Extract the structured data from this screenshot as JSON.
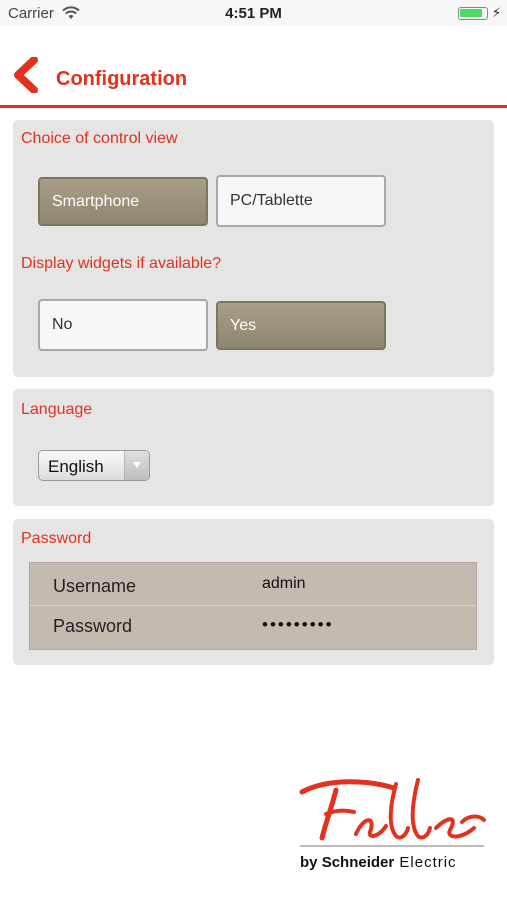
{
  "status_bar": {
    "carrier": "Carrier",
    "time": "4:51 PM",
    "battery_level": 1.0
  },
  "header": {
    "title": "Configuration",
    "back_icon": "chevron-left-icon"
  },
  "control_view": {
    "title": "Choice of control view",
    "options": [
      "Smartphone",
      "PC/Tablette"
    ],
    "selected": "Smartphone"
  },
  "widgets": {
    "title": "Display widgets if available?",
    "options": [
      "No",
      "Yes"
    ],
    "selected": "Yes"
  },
  "language": {
    "title": "Language",
    "selected": "English"
  },
  "password_section": {
    "title": "Password",
    "rows": [
      {
        "label": "Username",
        "value": "admin"
      },
      {
        "label": "Password",
        "value": "•••••••••"
      }
    ]
  },
  "logo": {
    "brand_script": "Feller",
    "tagline_by": "by ",
    "tagline_brand": "Schneider",
    "tagline_suffix": " Electric"
  },
  "colors": {
    "accent": "#e2311d",
    "selected_button": "#9b927b",
    "panel": "#e5e5e5"
  }
}
